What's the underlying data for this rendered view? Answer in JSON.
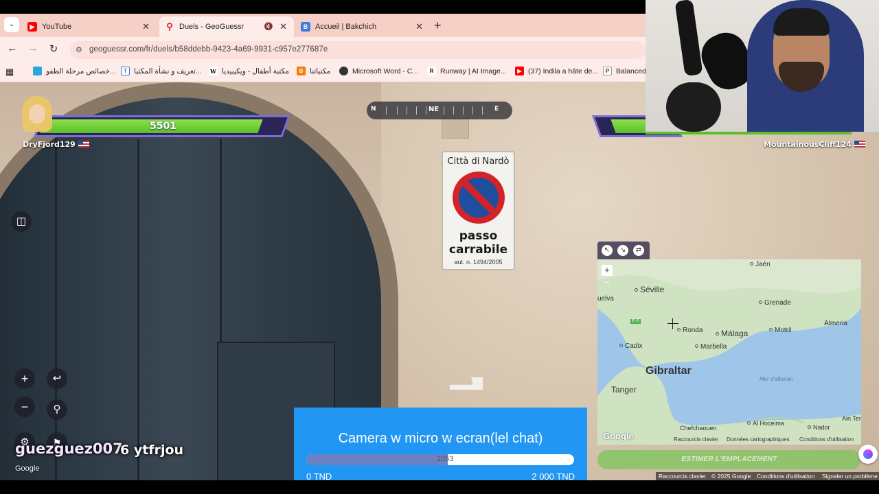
{
  "browser": {
    "tabs": [
      {
        "title": "YouTube",
        "favicon": "youtube-icon",
        "active": false
      },
      {
        "title": "Duels - GeoGuessr",
        "favicon": "location-pin-icon",
        "active": true,
        "muted": true
      },
      {
        "title": "Accueil | Bakchich",
        "favicon": "bakchich-b-icon",
        "active": false
      }
    ],
    "url": "geoguessr.com/fr/duels/b58ddebb-9423-4a69-9931-c957e277687e",
    "bookmarks": [
      {
        "label": "خصائص مرحلة الطفو...",
        "icon": "generic-site-icon"
      },
      {
        "label": "تعريف و نشأة المكتبا...",
        "icon": "document-icon"
      },
      {
        "label": "مكتبة أطفال - ويكيبيديا",
        "icon": "wikipedia-w-icon"
      },
      {
        "label": "مكتباتنا",
        "icon": "blogger-icon"
      },
      {
        "label": "Microsoft Word - C...",
        "icon": "globe-icon"
      },
      {
        "label": "Runway | AI Image...",
        "icon": "runway-icon"
      },
      {
        "label": "(37) Indila a hâte de...",
        "icon": "youtube-icon"
      },
      {
        "label": "Balanced",
        "icon": "p-icon"
      }
    ]
  },
  "scene": {
    "sign": {
      "title": "Città di Nardò",
      "line1": "passo",
      "line2": "carrabile",
      "line3": "aut. n. 1494/2005"
    }
  },
  "hud": {
    "player_left": {
      "name": "DryFjord129",
      "health": "5501",
      "health_fraction": 0.89
    },
    "player_right": {
      "name": "MountainousCliff124"
    },
    "compass": {
      "labels": [
        "N",
        "NE",
        "E"
      ]
    },
    "google_watermark": "Google"
  },
  "overlay": {
    "streamer_name": "guezguez007",
    "streamer_message": "6 ytfrjou",
    "donation": {
      "title": "Camera w micro w ecran(lel chat)",
      "current": "1053",
      "progress_fraction": 0.527,
      "min_label": "0 TND",
      "max_label": "2 000 TND",
      "bar_color": "#6a82c4",
      "bg_color": "#2196f3"
    }
  },
  "map": {
    "cities": [
      "Jaén",
      "Séville",
      "uelva",
      "Grenade",
      "Ronda",
      "Málaga",
      "Motril",
      "Almeria",
      "Cadix",
      "Marbella",
      "Gibraltar",
      "Mer d'alboran",
      "Tanger",
      "Chefchaouen",
      "Al Hoceima",
      "Nador",
      "Ain Tem"
    ],
    "road_label": "E-5",
    "logo": "Google",
    "footer_links": [
      "Raccourcis clavier",
      "Données cartographiques",
      "Conditions d'utilisation"
    ],
    "guess_button": "ESTIMER L'EMPLACEMENT"
  },
  "bottom_links": [
    "Raccourcis clavier",
    "© 2025 Google",
    "Conditions d'utilisation",
    "Signaler un problème"
  ]
}
